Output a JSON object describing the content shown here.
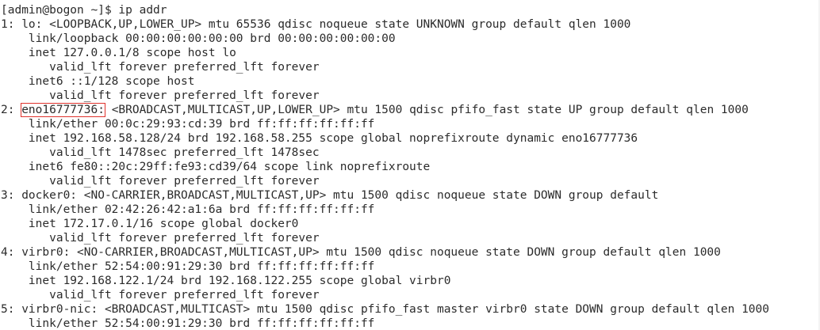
{
  "terminal": {
    "prompt": "[admin@bogon ~]$ ",
    "command": "ip addr",
    "highlight_color": "#e0322c",
    "lines": [
      {
        "pre": "1: lo: <LOOPBACK,UP,LOWER_UP> mtu 65536 qdisc noqueue state UNKNOWN group default qlen 1000",
        "hl": "",
        "post": ""
      },
      {
        "pre": "    link/loopback 00:00:00:00:00:00 brd 00:00:00:00:00:00",
        "hl": "",
        "post": ""
      },
      {
        "pre": "    inet 127.0.0.1/8 scope host lo",
        "hl": "",
        "post": ""
      },
      {
        "pre": "       valid_lft forever preferred_lft forever",
        "hl": "",
        "post": ""
      },
      {
        "pre": "    inet6 ::1/128 scope host",
        "hl": "",
        "post": ""
      },
      {
        "pre": "       valid_lft forever preferred_lft forever",
        "hl": "",
        "post": ""
      },
      {
        "pre": "2: ",
        "hl": "eno16777736:",
        "post": " <BROADCAST,MULTICAST,UP,LOWER_UP> mtu 1500 qdisc pfifo_fast state UP group default qlen 1000"
      },
      {
        "pre": "    link/ether 00:0c:29:93:cd:39 brd ff:ff:ff:ff:ff:ff",
        "hl": "",
        "post": ""
      },
      {
        "pre": "    inet 192.168.58.128/24 brd 192.168.58.255 scope global noprefixroute dynamic eno16777736",
        "hl": "",
        "post": ""
      },
      {
        "pre": "       valid_lft 1478sec preferred_lft 1478sec",
        "hl": "",
        "post": ""
      },
      {
        "pre": "    inet6 fe80::20c:29ff:fe93:cd39/64 scope link noprefixroute",
        "hl": "",
        "post": ""
      },
      {
        "pre": "       valid_lft forever preferred_lft forever",
        "hl": "",
        "post": ""
      },
      {
        "pre": "3: docker0: <NO-CARRIER,BROADCAST,MULTICAST,UP> mtu 1500 qdisc noqueue state DOWN group default",
        "hl": "",
        "post": ""
      },
      {
        "pre": "    link/ether 02:42:26:42:a1:6a brd ff:ff:ff:ff:ff:ff",
        "hl": "",
        "post": ""
      },
      {
        "pre": "    inet 172.17.0.1/16 scope global docker0",
        "hl": "",
        "post": ""
      },
      {
        "pre": "       valid_lft forever preferred_lft forever",
        "hl": "",
        "post": ""
      },
      {
        "pre": "4: virbr0: <NO-CARRIER,BROADCAST,MULTICAST,UP> mtu 1500 qdisc noqueue state DOWN group default qlen 1000",
        "hl": "",
        "post": ""
      },
      {
        "pre": "    link/ether 52:54:00:91:29:30 brd ff:ff:ff:ff:ff:ff",
        "hl": "",
        "post": ""
      },
      {
        "pre": "    inet 192.168.122.1/24 brd 192.168.122.255 scope global virbr0",
        "hl": "",
        "post": ""
      },
      {
        "pre": "       valid_lft forever preferred_lft forever",
        "hl": "",
        "post": ""
      },
      {
        "pre": "5: virbr0-nic: <BROADCAST,MULTICAST> mtu 1500 qdisc pfifo_fast master virbr0 state DOWN group default qlen 1000",
        "hl": "",
        "post": ""
      },
      {
        "pre": "    link/ether 52:54:00:91:29:30 brd ff:ff:ff:ff:ff:ff",
        "hl": "",
        "post": ""
      }
    ]
  }
}
